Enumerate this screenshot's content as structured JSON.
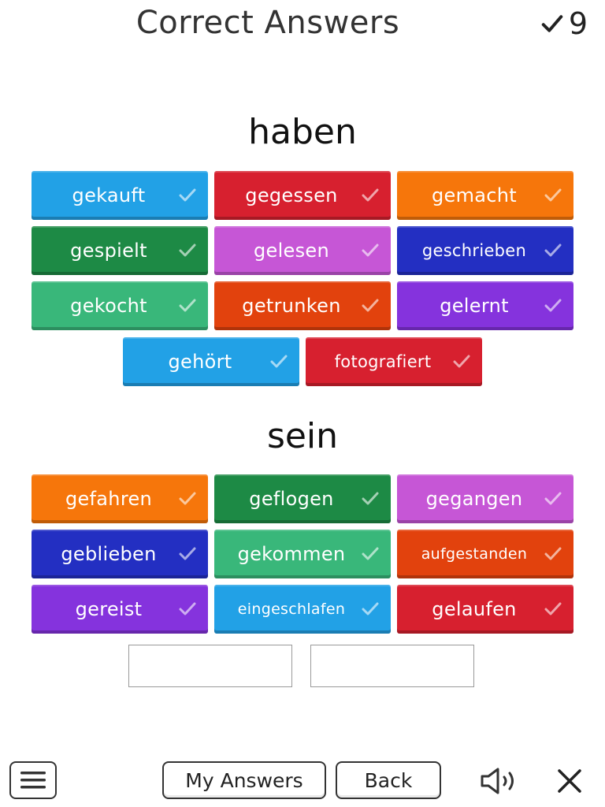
{
  "header": {
    "title": "Correct Answers",
    "score": "9"
  },
  "groups": [
    {
      "title": "haben",
      "chips": [
        {
          "label": "gekauft",
          "color": "#22a1e6"
        },
        {
          "label": "gegessen",
          "color": "#d7202f"
        },
        {
          "label": "gemacht",
          "color": "#f6760b"
        },
        {
          "label": "gespielt",
          "color": "#1d8a45"
        },
        {
          "label": "gelesen",
          "color": "#c656d6"
        },
        {
          "label": "geschrieben",
          "color": "#232fc2"
        },
        {
          "label": "gekocht",
          "color": "#39b77a"
        },
        {
          "label": "getrunken",
          "color": "#e2420d"
        },
        {
          "label": "gelernt",
          "color": "#8533dd"
        },
        {
          "label": "gehört",
          "color": "#22a1e6"
        },
        {
          "label": "fotografiert",
          "color": "#d7202f"
        }
      ]
    },
    {
      "title": "sein",
      "chips": [
        {
          "label": "gefahren",
          "color": "#f6760b"
        },
        {
          "label": "geflogen",
          "color": "#1d8a45"
        },
        {
          "label": "gegangen",
          "color": "#c656d6"
        },
        {
          "label": "geblieben",
          "color": "#232fc2"
        },
        {
          "label": "gekommen",
          "color": "#39b77a"
        },
        {
          "label": "aufgestanden",
          "color": "#e2420d"
        },
        {
          "label": "gereist",
          "color": "#8533dd"
        },
        {
          "label": "eingeschlafen",
          "color": "#22a1e6"
        },
        {
          "label": "gelaufen",
          "color": "#d7202f"
        }
      ]
    }
  ],
  "footer": {
    "my_answers_label": "My Answers",
    "back_label": "Back",
    "icons": [
      "menu-icon",
      "speaker-icon",
      "close-icon"
    ]
  }
}
